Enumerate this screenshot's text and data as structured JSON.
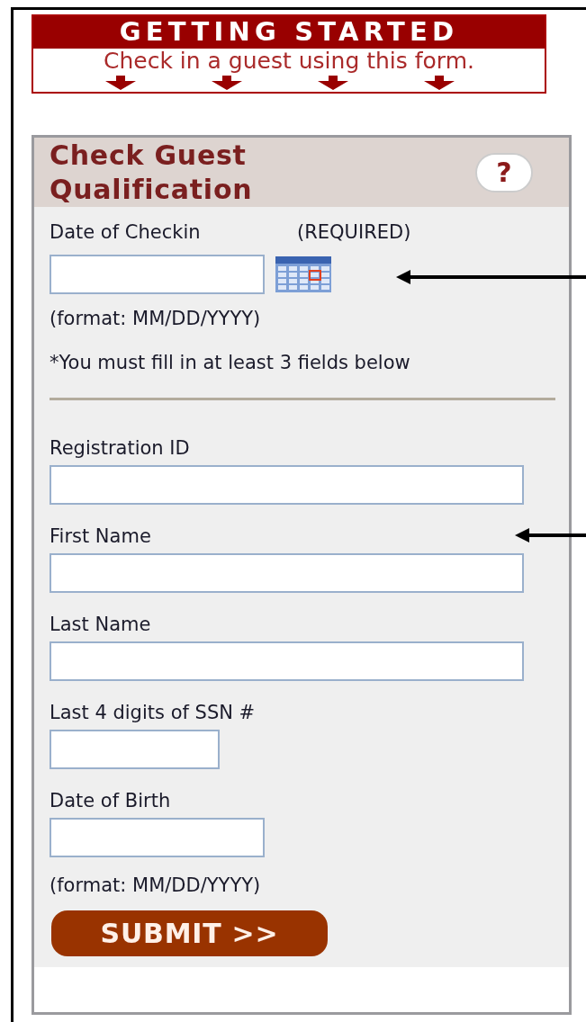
{
  "banner": {
    "title": "GETTING STARTED",
    "subtitle": "Check in a guest using this form."
  },
  "panel": {
    "title": "Check Guest Qualification",
    "help": "?",
    "checkin": {
      "label": "Date of Checkin",
      "required": "(REQUIRED)",
      "format": "(format: MM/DD/YYYY)"
    },
    "note": "*You must fill in at least 3 fields below",
    "fields": [
      {
        "label": "Registration ID",
        "kind": "long"
      },
      {
        "label": "First Name",
        "kind": "long"
      },
      {
        "label": "Last Name",
        "kind": "long"
      },
      {
        "label": "Last 4 digits of SSN #",
        "kind": "short"
      },
      {
        "label": "Date of Birth",
        "kind": "medium"
      }
    ],
    "dob_format": "(format: MM/DD/YYYY)",
    "submit": "SUBMIT >>"
  }
}
